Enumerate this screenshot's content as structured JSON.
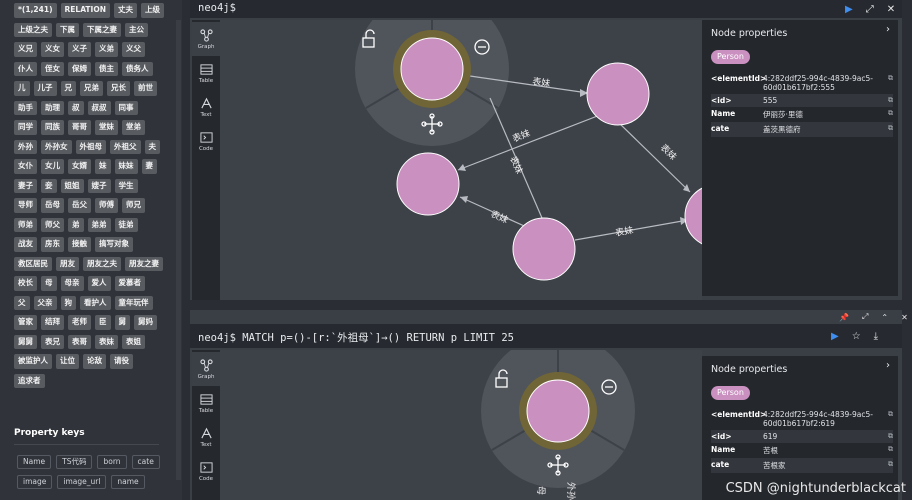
{
  "sidebar": {
    "relationship_types": [
      "*(1,241)",
      "RELATION",
      "丈夫",
      "上级",
      "上级之夫",
      "下属",
      "下属之妻",
      "主公",
      "义兄",
      "义女",
      "义子",
      "义弟",
      "义父",
      "仆人",
      "侄女",
      "保姆",
      "债主",
      "债务人",
      "儿",
      "儿子",
      "兄",
      "兄弟",
      "兄长",
      "前世",
      "助手",
      "助理",
      "叔",
      "叔叔",
      "同事",
      "同学",
      "同族",
      "哥哥",
      "堂妹",
      "堂弟",
      "外孙",
      "外孙女",
      "外祖母",
      "外祖父",
      "夫",
      "女仆",
      "女儿",
      "女婿",
      "妹",
      "妹妹",
      "妻",
      "妻子",
      "妾",
      "姐姐",
      "嫂子",
      "学生",
      "导师",
      "岳母",
      "岳父",
      "师傅",
      "师兄",
      "师弟",
      "师父",
      "弟",
      "弟弟",
      "徒弟",
      "战友",
      "房东",
      "接触",
      "搞写对象",
      "救区居民",
      "朋友",
      "朋友之夫",
      "朋友之妻",
      "校长",
      "母",
      "母亲",
      "爱人",
      "爱慕者",
      "父",
      "父亲",
      "狗",
      "看护人",
      "童年玩伴",
      "管家",
      "结拜",
      "老师",
      "臣",
      "舅",
      "舅妈",
      "舅舅",
      "表兄",
      "表哥",
      "表妹",
      "表姐",
      "被监护人",
      "让位",
      "论敌",
      "请役",
      "追求者"
    ],
    "property_keys_title": "Property keys",
    "property_keys": [
      "Name",
      "TS代码",
      "born",
      "cate",
      "image",
      "image_url",
      "name"
    ]
  },
  "panel1": {
    "prompt": "neo4j$",
    "tools": [
      {
        "label": "Graph"
      },
      {
        "label": "Table"
      },
      {
        "label": "Text"
      },
      {
        "label": "Code"
      }
    ],
    "edge_labels": [
      "表妹",
      "表妹",
      "表妹",
      "表妹",
      "表妹",
      "表妹"
    ],
    "props": {
      "title": "Node properties",
      "label": "Person",
      "rows": [
        {
          "k": "<elementId>",
          "v": "4:282ddf25-994c-4839-9ac5-60d01b617bf2:555"
        },
        {
          "k": "<id>",
          "v": "555"
        },
        {
          "k": "Name",
          "v": "伊丽莎·里德"
        },
        {
          "k": "cate",
          "v": "盖茨黑德府"
        }
      ]
    }
  },
  "panel2": {
    "prompt": "neo4j$ MATCH p=()-[r:`外祖母`]→() RETURN p LIMIT 25",
    "tools": [
      {
        "label": "Graph"
      },
      {
        "label": "Table"
      },
      {
        "label": "Text"
      },
      {
        "label": "Code"
      }
    ],
    "edge_labels": [
      "母",
      "外孙"
    ],
    "props": {
      "title": "Node properties",
      "label": "Person",
      "rows": [
        {
          "k": "<elementId>",
          "v": "4:282ddf25-994c-4839-9ac5-60d01b617bf2:619"
        },
        {
          "k": "<id>",
          "v": "619"
        },
        {
          "k": "Name",
          "v": "苦根"
        },
        {
          "k": "cate",
          "v": "苦根家"
        }
      ]
    }
  },
  "watermark": "CSDN @nightunderblackcat",
  "colors": {
    "node": "#c990c0",
    "ring": "#6f6537",
    "accent": "#3d8ef0"
  }
}
